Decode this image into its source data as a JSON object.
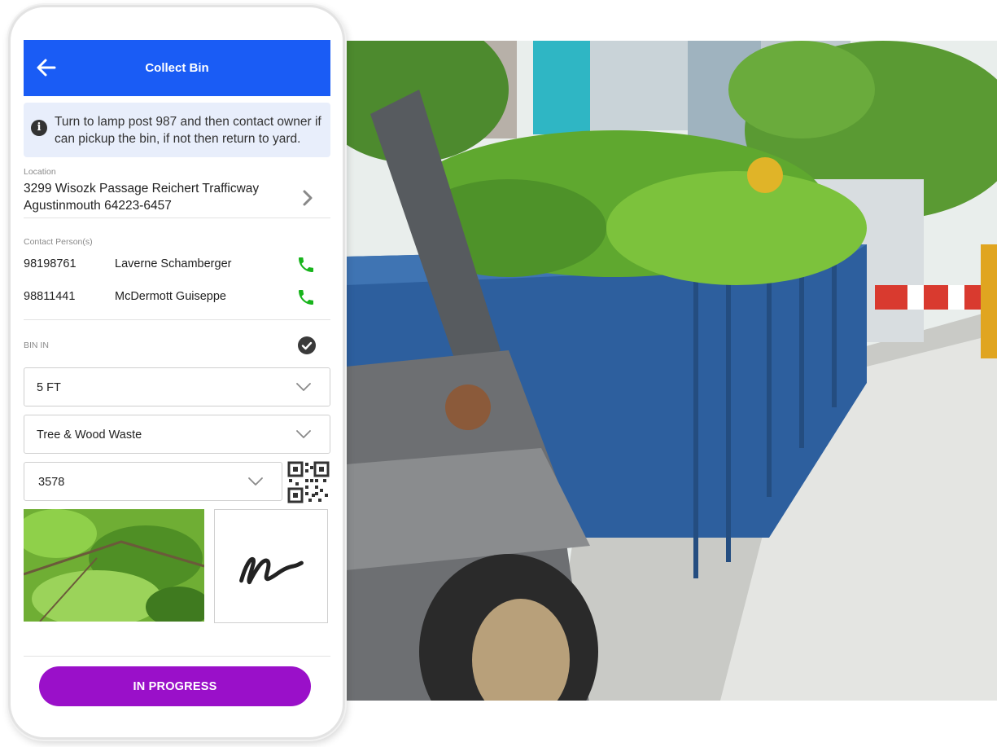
{
  "app": {
    "title": "Collect Bin"
  },
  "notice": {
    "text": "Turn to lamp post 987 and then contact owner if can pickup the bin, if not then return to yard."
  },
  "location": {
    "label": "Location",
    "line1": "3299 Wisozk Passage Reichert Trafficway",
    "line2": "Agustinmouth 64223-6457"
  },
  "contacts": {
    "label": "Contact Person(s)",
    "items": [
      {
        "phone": "98198761",
        "name": "Laverne Schamberger"
      },
      {
        "phone": "98811441",
        "name": "McDermott Guiseppe"
      }
    ]
  },
  "bin_in": {
    "label": "BIN IN"
  },
  "fields": {
    "size": "5 FT",
    "waste_type": "Tree & Wood Waste",
    "bin_number": "3578"
  },
  "status_button": {
    "label": "IN PROGRESS"
  },
  "colors": {
    "appbar": "#1a5cf5",
    "status_button": "#9a10c9",
    "call_icon": "#18b41c",
    "notice_bg": "#e8eefb"
  },
  "icons": {
    "back": "arrow-left-icon",
    "info": "info-icon",
    "next": "chevron-right-icon",
    "call": "phone-icon",
    "check": "check-circle-icon",
    "dropdown": "chevron-down-icon",
    "qr": "qr-code-icon"
  }
}
